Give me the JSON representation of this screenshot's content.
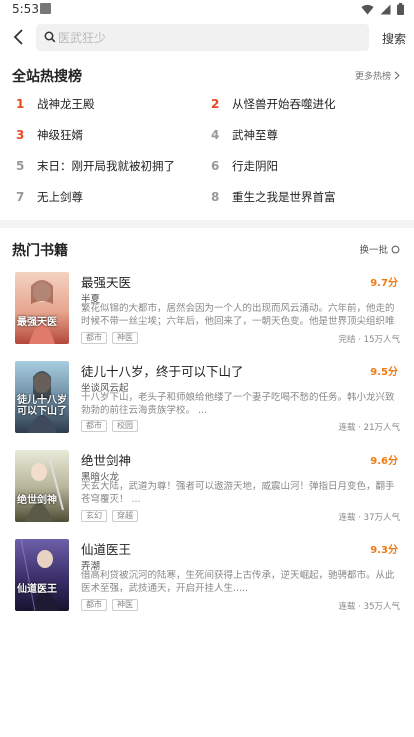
{
  "status_bar": {
    "time": "5:53"
  },
  "search": {
    "placeholder": "医武狂少",
    "button": "搜索"
  },
  "hot_section": {
    "title": "全站热搜榜",
    "more": "更多热榜",
    "items": [
      {
        "rank": "1",
        "name": "战神龙王殿"
      },
      {
        "rank": "2",
        "name": "从怪兽开始吞噬进化"
      },
      {
        "rank": "3",
        "name": "神级狂婿"
      },
      {
        "rank": "4",
        "name": "武神至尊"
      },
      {
        "rank": "5",
        "name": "末日：刚开局我就被初拥了"
      },
      {
        "rank": "6",
        "name": "行走阴阳"
      },
      {
        "rank": "7",
        "name": "无上剑尊"
      },
      {
        "rank": "8",
        "name": "重生之我是世界首富"
      }
    ]
  },
  "books_section": {
    "title": "热门书籍",
    "refresh": "换一批",
    "books": [
      {
        "title": "最强天医",
        "score": "9.7分",
        "author": "半夏",
        "desc": "繁花似锦的大都市，居然会因为一个人的出现而风云涌动。六年前，他走的时候不带一丝尘埃；六年后，他回来了，一朝天色变。他是世界顶尖组织唯一…",
        "tags": [
          "都市",
          "神医"
        ],
        "status": "完结",
        "popularity": "15万人气",
        "cover_text": "最强天医",
        "cover_colors": [
          "#f0c7b8",
          "#c0604a"
        ]
      },
      {
        "title": "徒儿十八岁，终于可以下山了",
        "score": "9.5分",
        "author": "坐谈风云起",
        "desc": "十八岁下山，老头子和师娘给他缕了一个妻子吃喝不愁的任务。韩小龙兴致勃勃的前往云海贵族学校。 ...",
        "tags": [
          "都市",
          "校园"
        ],
        "status": "连载",
        "popularity": "21万人气",
        "cover_text": "徒儿十八岁可以下山了",
        "cover_colors": [
          "#8fb7cf",
          "#3a4e63"
        ]
      },
      {
        "title": "绝世剑神",
        "score": "9.6分",
        "author": "黑暗火龙",
        "desc": "天玄大陆，武道为尊！强者可以遨游天地，威震山河！弹指日月变色，翻手苍穹覆灭！ ...",
        "tags": [
          "玄幻",
          "穿越"
        ],
        "status": "连载",
        "popularity": "37万人气",
        "cover_text": "绝世剑神",
        "cover_colors": [
          "#d8dccb",
          "#6b6a4c"
        ]
      },
      {
        "title": "仙道医王",
        "score": "9.3分",
        "author": "弄潮",
        "desc": "借高利贷被沉河的陆寒，生死间获得上古传承，逆天崛起，驰骋都市。从此医术至强，武技通天，开启开挂人生.....",
        "tags": [
          "都市",
          "神医"
        ],
        "status": "连载",
        "popularity": "35万人气",
        "cover_text": "仙道医王",
        "cover_colors": [
          "#4a3f7a",
          "#1b1535"
        ]
      }
    ]
  },
  "colors": {
    "accent": "#e8491f",
    "score": "#ee7a14"
  }
}
